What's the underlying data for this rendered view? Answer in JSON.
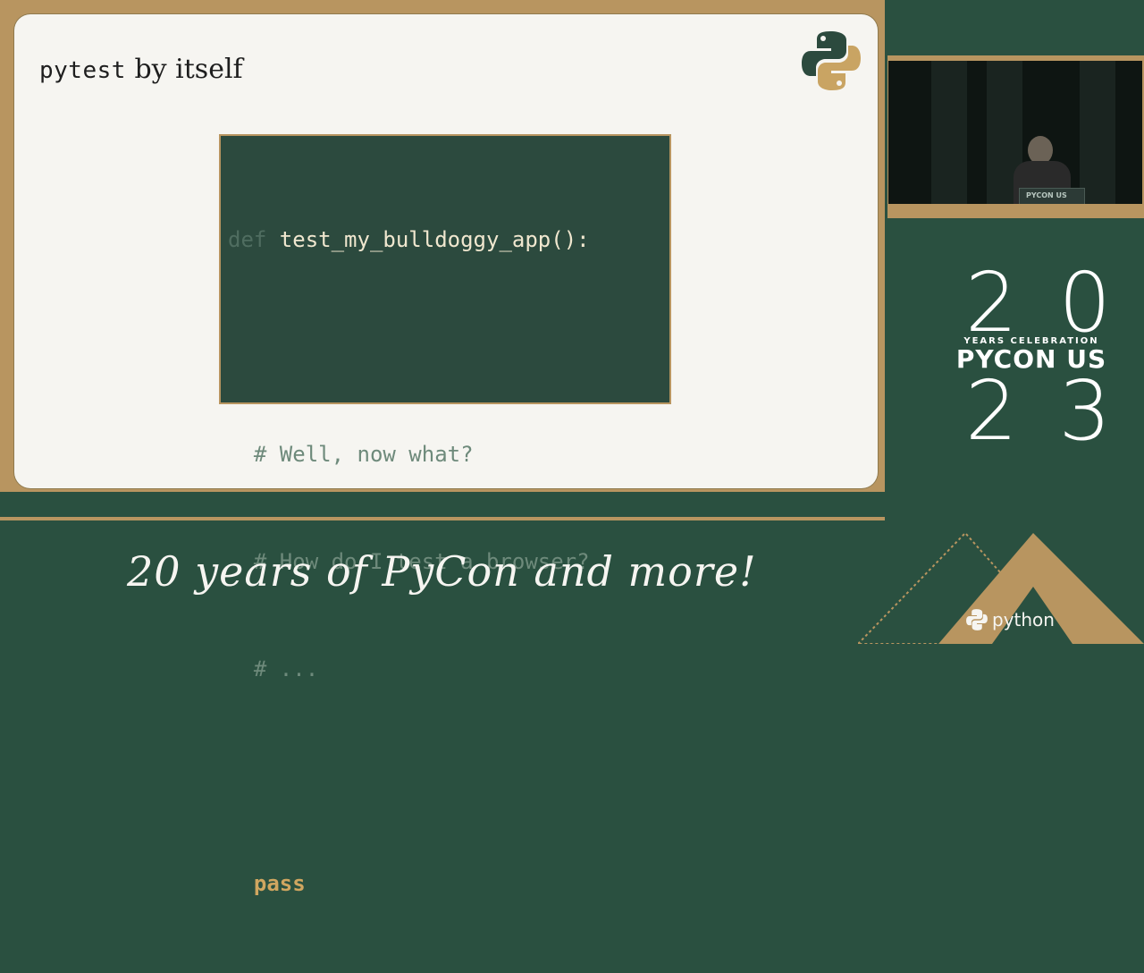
{
  "slide": {
    "title_mono": "pytest",
    "title_rest": " by itself",
    "code": {
      "line1_kw": "def",
      "line1_fn": " test_my_bulldoggy_app():",
      "comment1": "  # Well, now what?",
      "comment2": "  # How do I test a browser?",
      "comment3": "  # ...",
      "pass_kw": "  pass"
    }
  },
  "video": {
    "podium_label": "PYCON US"
  },
  "event": {
    "year_top": "20",
    "celebration": "YEARS CELEBRATION",
    "name": "PYCON US",
    "year_bottom": "23",
    "tagline": "20 years of PyCon and more!",
    "footer_logo": "python"
  },
  "colors": {
    "dark_green": "#2a5040",
    "gold": "#b89560",
    "slide_bg": "#f6f5f1",
    "code_bg": "#2c4a3e"
  },
  "icons": {
    "slide_logo": "python-logo-icon",
    "footer_logo": "python-logo-icon"
  }
}
